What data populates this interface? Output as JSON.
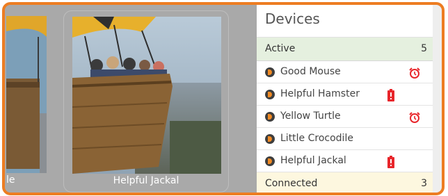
{
  "gallery": {
    "cards": [
      {
        "label": "le"
      },
      {
        "label": "Helpful Jackal"
      }
    ]
  },
  "panel": {
    "title": "Devices",
    "groups": [
      {
        "label": "Active",
        "count": "5",
        "devices": [
          {
            "name": "Good Mouse",
            "status_icon": "alarm-clock-icon"
          },
          {
            "name": "Helpful Hamster",
            "status_icon": "battery-low-icon"
          },
          {
            "name": "Yellow Turtle",
            "status_icon": "alarm-clock-icon"
          },
          {
            "name": "Little Crocodile",
            "status_icon": ""
          },
          {
            "name": "Helpful Jackal",
            "status_icon": "battery-low-icon"
          }
        ]
      },
      {
        "label": "Connected",
        "count": "3"
      }
    ]
  },
  "colors": {
    "frame_border": "#ed7d22",
    "active_group_bg": "#e5f0df",
    "connected_group_bg": "#fdf7df",
    "alert_red": "#e8262b"
  }
}
